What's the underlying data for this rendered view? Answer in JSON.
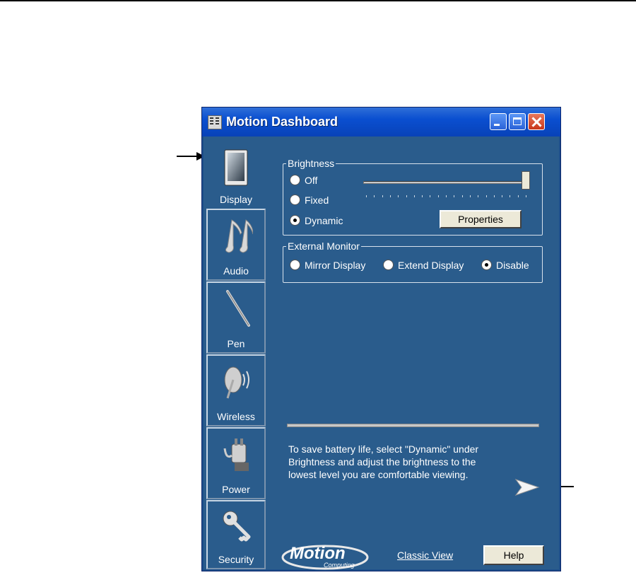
{
  "window": {
    "title": "Motion Dashboard"
  },
  "titlebar_buttons": [
    "minimize-button",
    "maximize-button",
    "close-button"
  ],
  "sidebar": {
    "items": [
      {
        "label": "Display",
        "icon": "display-tablet-icon",
        "selected": true
      },
      {
        "label": "Audio",
        "icon": "music-notes-icon"
      },
      {
        "label": "Pen",
        "icon": "pen-stylus-icon"
      },
      {
        "label": "Wireless",
        "icon": "wireless-antenna-icon"
      },
      {
        "label": "Power",
        "icon": "power-plug-icon"
      },
      {
        "label": "Security",
        "icon": "key-icon"
      }
    ]
  },
  "brightness": {
    "legend": "Brightness",
    "options": [
      "Off",
      "Fixed",
      "Dynamic"
    ],
    "selected": "Dynamic",
    "slider_level": 1.0,
    "properties_button": "Properties"
  },
  "external_monitor": {
    "legend": "External Monitor",
    "options": [
      "Mirror Display",
      "Extend Display",
      "Disable"
    ],
    "selected": "Disable"
  },
  "tip": {
    "line1": "To save battery life, select \"Dynamic\" under",
    "line2": "Brightness and adjust the brightness to the",
    "line3": "lowest level you are comfortable viewing."
  },
  "footer": {
    "logo_text": "Motion",
    "logo_subtext": "Computing",
    "classic_view": "Classic View",
    "help_button": "Help"
  },
  "colors": {
    "window_bg": "#2a5c8c",
    "titlebar": "#0a4fd0",
    "text": "#ffffff"
  }
}
